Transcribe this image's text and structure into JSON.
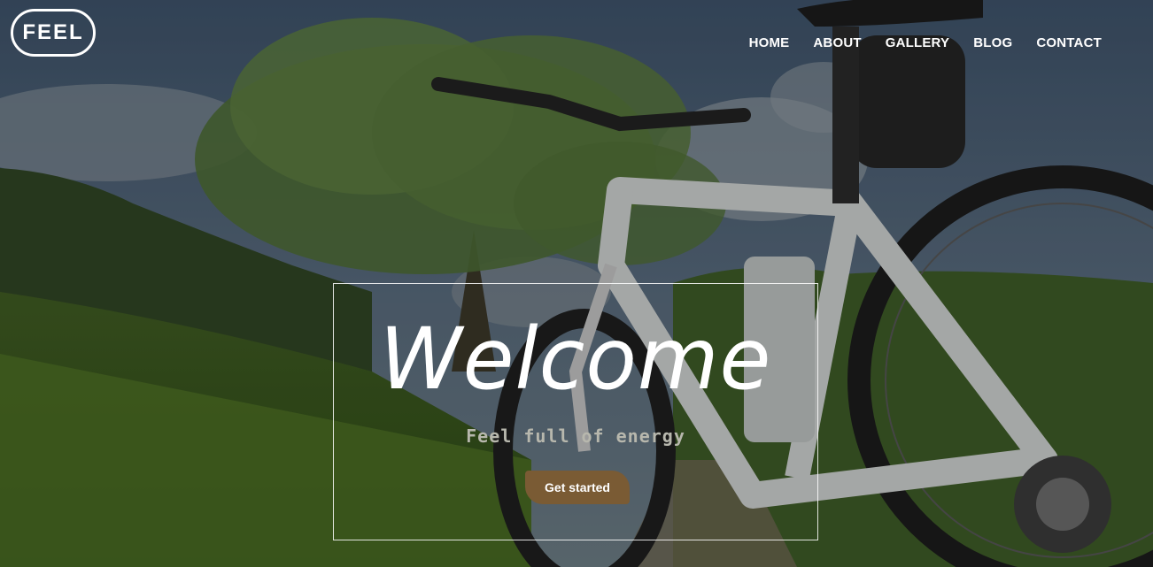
{
  "brand": {
    "logo_text": "FEEL"
  },
  "nav": {
    "items": [
      {
        "label": "HOME"
      },
      {
        "label": "ABOUT"
      },
      {
        "label": "GALLERY"
      },
      {
        "label": "BLOG"
      },
      {
        "label": "CONTACT"
      }
    ]
  },
  "hero": {
    "title": "Welcome",
    "subtitle": "Feel full of energy",
    "cta_label": "Get started"
  },
  "colors": {
    "cta_background": "#7a5b34",
    "subtitle_text": "#b7b7ad",
    "nav_text": "#ffffff"
  }
}
